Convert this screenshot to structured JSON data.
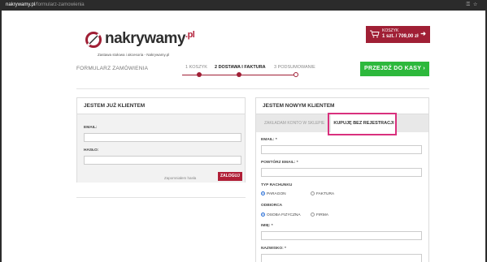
{
  "browser": {
    "host": "nakrywamy.pl",
    "path": "/formularz-zamowienia",
    "icons": [
      "key-icon",
      "star-icon"
    ]
  },
  "logo": {
    "name": "nakrywamy",
    "suffix": ".pl",
    "tagline": "Zastawa stołowa i akcesoria - Nakrywamy.pl"
  },
  "cart": {
    "label": "KOSZYK",
    "summary": "1 szt. / 709,00 zł",
    "arrow": "➜"
  },
  "checkout": {
    "form_title": "FORMULARZ ZAMÓWIENIA",
    "steps": [
      {
        "label": "1 KOSZYK",
        "state": "done"
      },
      {
        "label": "2 DOSTAWA I FAKTURA",
        "state": "active"
      },
      {
        "label": "3 PODSUMOWANIE",
        "state": "todo"
      }
    ],
    "next_button": "PRZEJDŹ DO KASY  ›"
  },
  "existing_customer": {
    "heading": "JESTEM JUŻ KLIENTEM",
    "email_label": "EMAIL:",
    "password_label": "HASŁO:",
    "forgot_link": "Zapomniałem hasła",
    "login_button": "ZALOGUJ"
  },
  "new_customer": {
    "heading": "JESTEM NOWYM KLIENTEM",
    "tab_create_account": "ZAKŁADAM KONTO W SKLEPIE",
    "tab_no_registration": "KUPUJĘ BEZ REJESTRACJI",
    "email_label": "EMAIL: *",
    "repeat_email_label": "POWTÓRZ EMAIL: *",
    "account_type_label": "TYP RACHUNKU",
    "account_type_options": [
      "PARAGON",
      "FAKTURA"
    ],
    "account_type_selected": "PARAGON",
    "recipient_label": "ODBIORCA",
    "recipient_options": [
      "OSOBA FIZYCZNA",
      "FIRMA"
    ],
    "recipient_selected": "OSOBA FIZYCZNA",
    "first_name_label": "IMIĘ: *",
    "last_name_label": "NAZWISKO: *"
  },
  "colors": {
    "brand": "#a01f35",
    "cta": "#2db83c",
    "highlight": "#d9307d",
    "radio_selected": "#2a6fd6"
  }
}
